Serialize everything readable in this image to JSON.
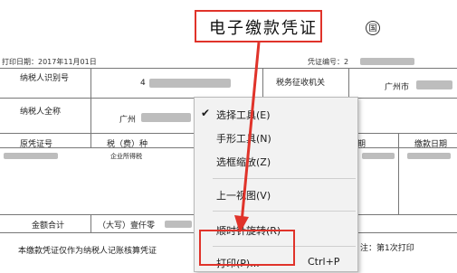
{
  "document": {
    "title": "电子缴款凭证",
    "seal": "国",
    "print_date": "打印日期：2017年11月01日",
    "cert_no": "凭证编号：2",
    "rows": {
      "taxpayer_id": "纳税人识别号",
      "id_value_prefix": "4",
      "tax_office_label": "税务征收机关",
      "city": "广州市",
      "taxpayer_name": "纳税人全称",
      "name_value_prefix": "广州",
      "original_voucher": "原凭证号",
      "tax_type": "税（费）种",
      "period": "期",
      "pay_date": "缴款日期",
      "tax_item": "企业所得税",
      "amount_total": "金额合计",
      "amount_words": "（大写）壹仟零",
      "notice": "本缴款凭证仅作为纳税人记账核算凭证",
      "print_count": "注：第1次打印"
    }
  },
  "context_menu": {
    "items": [
      {
        "label": "选择工具(E)",
        "checked": true
      },
      {
        "label": "手形工具(N)",
        "checked": false
      },
      {
        "label": "选框缩放(Z)",
        "checked": false
      },
      {
        "label": "上一视图(V)",
        "checked": false
      },
      {
        "label": "顺时针旋转(R)",
        "checked": false
      },
      {
        "label": "打印(P)...",
        "shortcut": "Ctrl+P",
        "checked": false
      }
    ],
    "check_glyph": "✔"
  },
  "colors": {
    "highlight": "#e0332a",
    "menu_bg": "#f2f2f2"
  }
}
